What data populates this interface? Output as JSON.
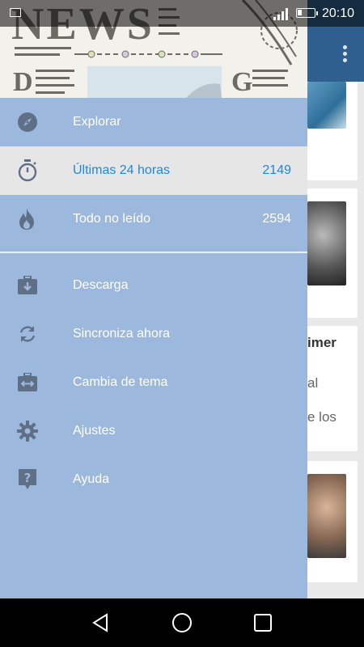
{
  "status_bar": {
    "time": "20:10"
  },
  "drawer": {
    "items": [
      {
        "label": "Explorar",
        "count": "",
        "icon": "compass-icon",
        "active": false
      },
      {
        "label": "Últimas 24 horas",
        "count": "2149",
        "icon": "stopwatch-icon",
        "active": true
      },
      {
        "label": "Todo no leído",
        "count": "2594",
        "icon": "flame-icon",
        "active": false
      },
      {
        "label": "Descarga",
        "count": "",
        "icon": "download-briefcase-icon",
        "active": false
      },
      {
        "label": "Sincroniza ahora",
        "count": "",
        "icon": "sync-icon",
        "active": false
      },
      {
        "label": "Cambia de tema",
        "count": "",
        "icon": "theme-swap-icon",
        "active": false
      },
      {
        "label": "Ajustes",
        "count": "",
        "icon": "gear-icon",
        "active": false
      },
      {
        "label": "Ayuda",
        "count": "",
        "icon": "help-icon",
        "active": false
      }
    ]
  },
  "background": {
    "snippets": [
      "imer",
      "al",
      "e los"
    ]
  },
  "colors": {
    "drawer_bg": "#9db8dd",
    "active_bg": "#e6e6e6",
    "active_text": "#1e88d8",
    "icon": "#5f6f86",
    "toolbar": "#2f5f8f"
  }
}
